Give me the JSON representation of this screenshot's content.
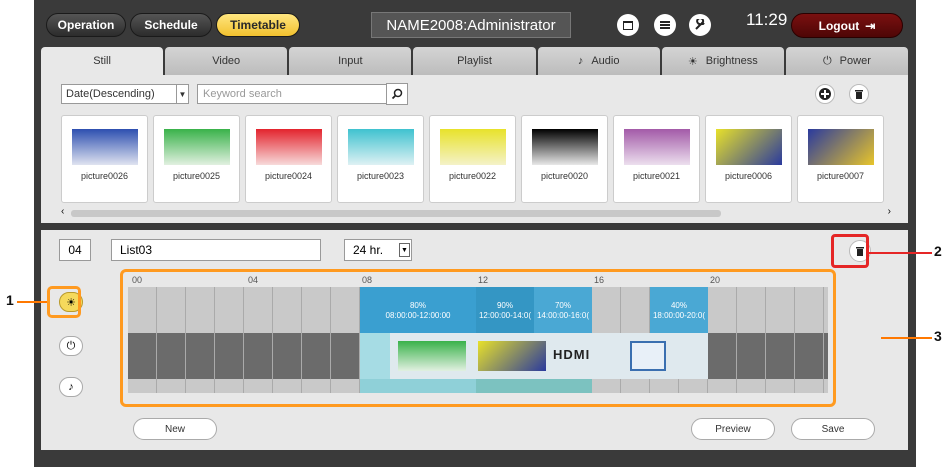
{
  "header": {
    "nav": [
      "Operation",
      "Schedule",
      "Timetable"
    ],
    "active_nav": "Timetable",
    "title": "NAME2008:Administrator",
    "icons": [
      "calendar-icon",
      "list-icon",
      "wrench-icon"
    ],
    "time": "11:29",
    "logout_label": "Logout"
  },
  "tabs": [
    {
      "label": "Still",
      "icon": ""
    },
    {
      "label": "Video",
      "icon": ""
    },
    {
      "label": "Input",
      "icon": ""
    },
    {
      "label": "Playlist",
      "icon": ""
    },
    {
      "label": "Audio",
      "icon": "note-icon"
    },
    {
      "label": "Brightness",
      "icon": "sun-icon"
    },
    {
      "label": "Power",
      "icon": "power-icon"
    }
  ],
  "still_panel": {
    "sort_select": "Date(Descending)",
    "search_placeholder": "Keyword search",
    "thumbnails": [
      {
        "name": "picture0026",
        "grad": "linear-gradient(#2d4fb0,#dfe3f0)"
      },
      {
        "name": "picture0025",
        "grad": "linear-gradient(#39b24a,#e1f0e0)"
      },
      {
        "name": "picture0024",
        "grad": "linear-gradient(#e3232d,#f7dada)"
      },
      {
        "name": "picture0023",
        "grad": "linear-gradient(#3fc2cf,#def1f3)"
      },
      {
        "name": "picture0022",
        "grad": "linear-gradient(#e8e22a,#f4f2c8)"
      },
      {
        "name": "picture0020",
        "grad": "linear-gradient(#000000,#e8e8e8)"
      },
      {
        "name": "picture0021",
        "grad": "linear-gradient(#a35aa8,#ecdfee)"
      },
      {
        "name": "picture0006",
        "grad": "linear-gradient(135deg,#e8e12a,#2a3a9e)"
      },
      {
        "name": "picture0007",
        "grad": "linear-gradient(135deg,#2a3a9e,#e8c52a)"
      }
    ]
  },
  "timetable": {
    "list_number": "04",
    "list_name": "List03",
    "hour_mode": "24 hr.",
    "tick_labels": [
      "00",
      "04",
      "08",
      "12",
      "16",
      "20"
    ],
    "brightness_segments": [
      {
        "percent": "80%",
        "range": "08:00:00-12:00:00"
      },
      {
        "percent": "90%",
        "range": "12:00:00-14:0("
      },
      {
        "percent": "70%",
        "range": "14:00:00-16:0("
      },
      {
        "percent": "40%",
        "range": "18:00:00-20:0("
      }
    ],
    "media_labels": [
      "HDMI"
    ],
    "buttons": {
      "new": "New",
      "preview": "Preview",
      "save": "Save"
    }
  },
  "callouts": [
    "1",
    "2",
    "3"
  ],
  "colors": {
    "accent_yellow": "#f2c12e",
    "logout_red": "#6a0b0b",
    "timeline_blue": "#3a9fd0",
    "callout_orange": "#ff7800",
    "callout_red": "#e52626"
  }
}
